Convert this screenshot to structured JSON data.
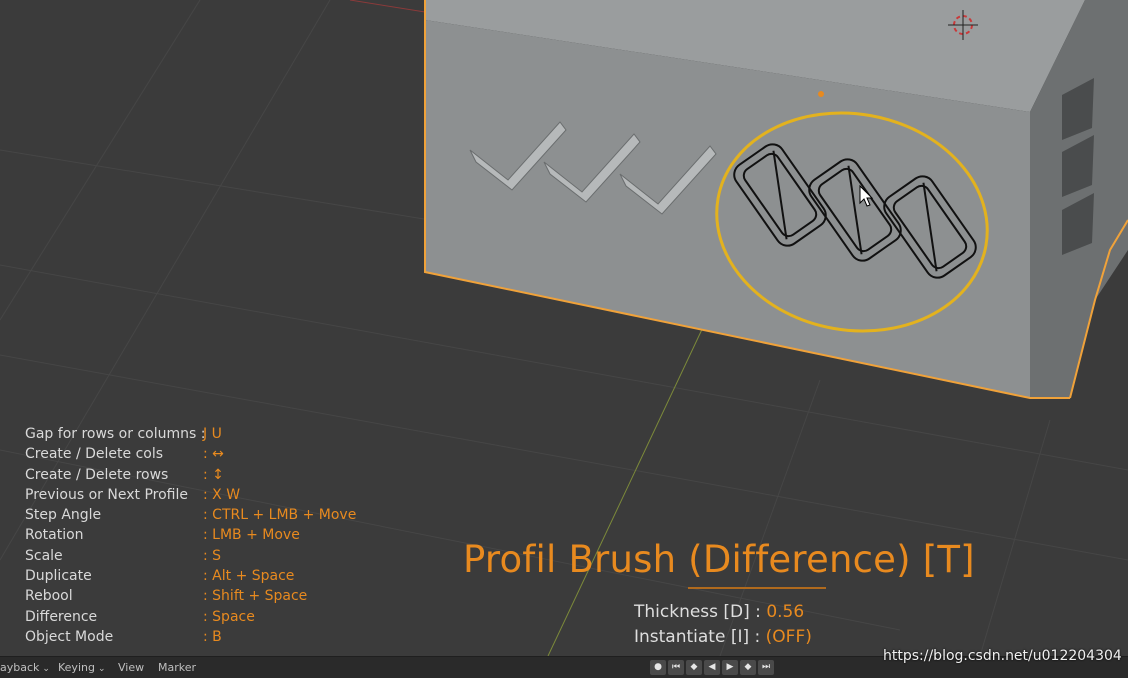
{
  "shortcuts": [
    {
      "label": "Gap for rows or columns :",
      "key": "J U"
    },
    {
      "label": "Create / Delete cols",
      "key": ": ↔"
    },
    {
      "label": "Create / Delete rows",
      "key": ": ↕"
    },
    {
      "label": "Previous or Next Profile",
      "key": ": X W"
    },
    {
      "label": "Step Angle",
      "key": ": CTRL + LMB + Move"
    },
    {
      "label": "Rotation",
      "key": ": LMB + Move"
    },
    {
      "label": "Scale",
      "key": ": S"
    },
    {
      "label": "Duplicate",
      "key": ": Alt + Space"
    },
    {
      "label": "Rebool",
      "key": ": Shift + Space"
    },
    {
      "label": "Difference",
      "key": ": Space"
    },
    {
      "label": "Object Mode",
      "key": ": B"
    }
  ],
  "brush": {
    "title": "Profil Brush (Difference) [T]",
    "thickness_label": "Thickness [D] :",
    "thickness_value": "0.56",
    "instantiate_label": "Instantiate [I] :",
    "instantiate_value": "(OFF)"
  },
  "timeline_menu": {
    "playback": "ayback",
    "keying": "Keying",
    "view": "View",
    "marker": "Marker"
  },
  "transport_icons": [
    "record-icon",
    "jump-start-icon",
    "prev-keyframe-icon",
    "play-reverse-icon",
    "play-icon",
    "next-keyframe-icon",
    "jump-end-icon"
  ],
  "watermark": "https://blog.csdn.net/u012204304",
  "colors": {
    "accent": "#e88a1f",
    "selection_outline": "#f0a23a",
    "brush_circle": "#e3b21e",
    "background": "#3b3b3b",
    "mesh": "#8f9293"
  }
}
